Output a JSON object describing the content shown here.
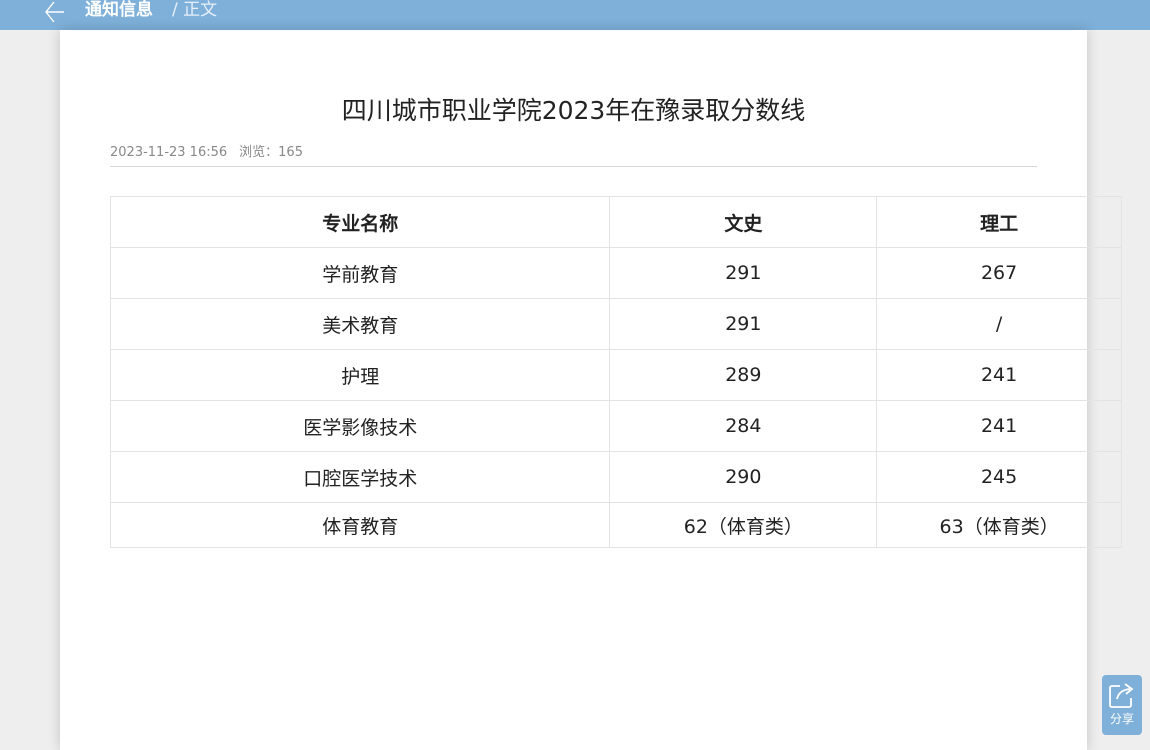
{
  "header": {
    "back_icon": "back-arrow-icon",
    "section": "通知信息",
    "crumb": "/ 正文"
  },
  "article": {
    "title": "四川城市职业学院2023年在豫录取分数线",
    "date": "2023-11-23 16:56",
    "views": "浏览：165"
  },
  "table": {
    "headers": [
      "专业名称",
      "文史",
      "理工"
    ],
    "rows": [
      [
        "学前教育",
        "291",
        "267"
      ],
      [
        "美术教育",
        "291",
        "/"
      ],
      [
        "护理",
        "289",
        "241"
      ],
      [
        "医学影像技术",
        "284",
        "241"
      ],
      [
        "口腔医学技术",
        "290",
        "245"
      ],
      [
        "体育教育",
        "62（体育类）",
        "63（体育类）"
      ]
    ]
  },
  "share": {
    "icon": "share-icon",
    "label": "分享"
  },
  "colors": {
    "header_bg": "#7eb0d9",
    "page_bg": "#eeeeee",
    "card_bg": "#ffffff"
  }
}
